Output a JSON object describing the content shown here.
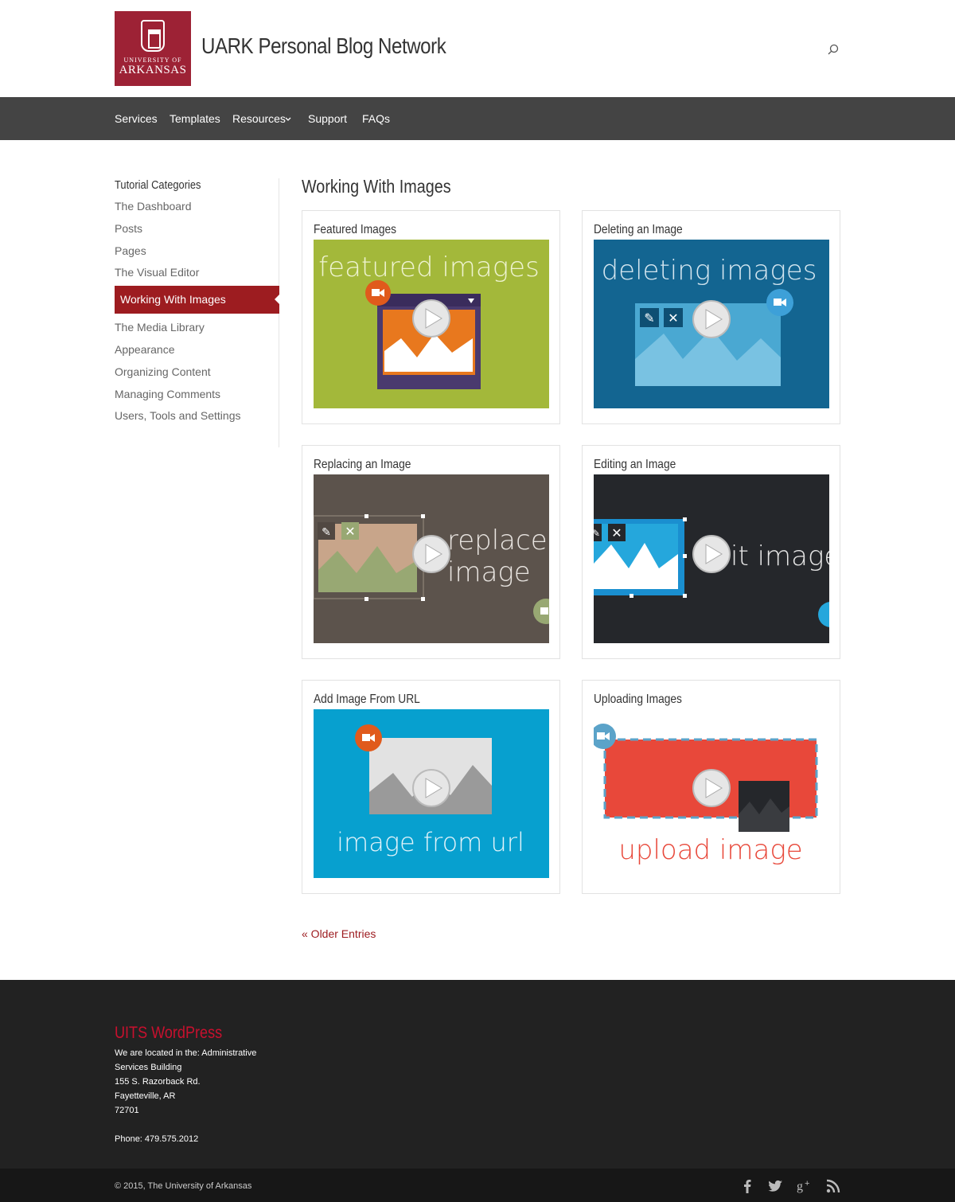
{
  "header": {
    "logo_line1": "UNIVERSITY OF",
    "logo_line2": "ARKANSAS",
    "site_title": "UARK Personal Blog Network",
    "search_icon": "search-icon"
  },
  "nav": {
    "items": [
      "Services",
      "Templates",
      "Resources",
      "Support",
      "FAQs"
    ],
    "dropdown_icon": "chevron-down-icon"
  },
  "sidebar": {
    "title": "Tutorial Categories",
    "items": [
      "The Dashboard",
      "Posts",
      "Pages",
      "The Visual Editor",
      "Working With Images",
      "The Media Library",
      "Appearance",
      "Organizing Content",
      "Managing Comments",
      "Users, Tools and Settings"
    ],
    "active_index": 4
  },
  "main": {
    "title": "Working With Images",
    "cards": [
      {
        "title": "Featured Images",
        "thumb_text": "featured images",
        "bg": "#a3b83a"
      },
      {
        "title": "Deleting an Image",
        "thumb_text": "deleting images",
        "bg": "#136591"
      },
      {
        "title": "Replacing an Image",
        "thumb_text_1": "replace",
        "thumb_text_2": "image",
        "bg": "#5c534c"
      },
      {
        "title": "Editing an Image",
        "thumb_text": "it image",
        "bg": "#25272b"
      },
      {
        "title": "Add Image From URL",
        "thumb_text": "image from url",
        "bg": "#07a0cf"
      },
      {
        "title": "Uploading Images",
        "thumb_text": "upload image",
        "bg": "#ffffff"
      }
    ],
    "older_entries": "« Older Entries"
  },
  "footer": {
    "title": "UITS WordPress",
    "address_lines": [
      "We are located in the: Administrative",
      "Services Building",
      "155 S. Razorback Rd.",
      "Fayetteville, AR",
      "72701"
    ],
    "phone": "Phone: 479.575.2012",
    "copyright": "© 2015, The University of Arkansas",
    "social_icons": [
      "facebook-icon",
      "twitter-icon",
      "google-plus-icon",
      "rss-icon"
    ]
  },
  "colors": {
    "brand_red": "#9d1c20",
    "nav_bg": "#444444",
    "footer_bg": "#222222"
  }
}
